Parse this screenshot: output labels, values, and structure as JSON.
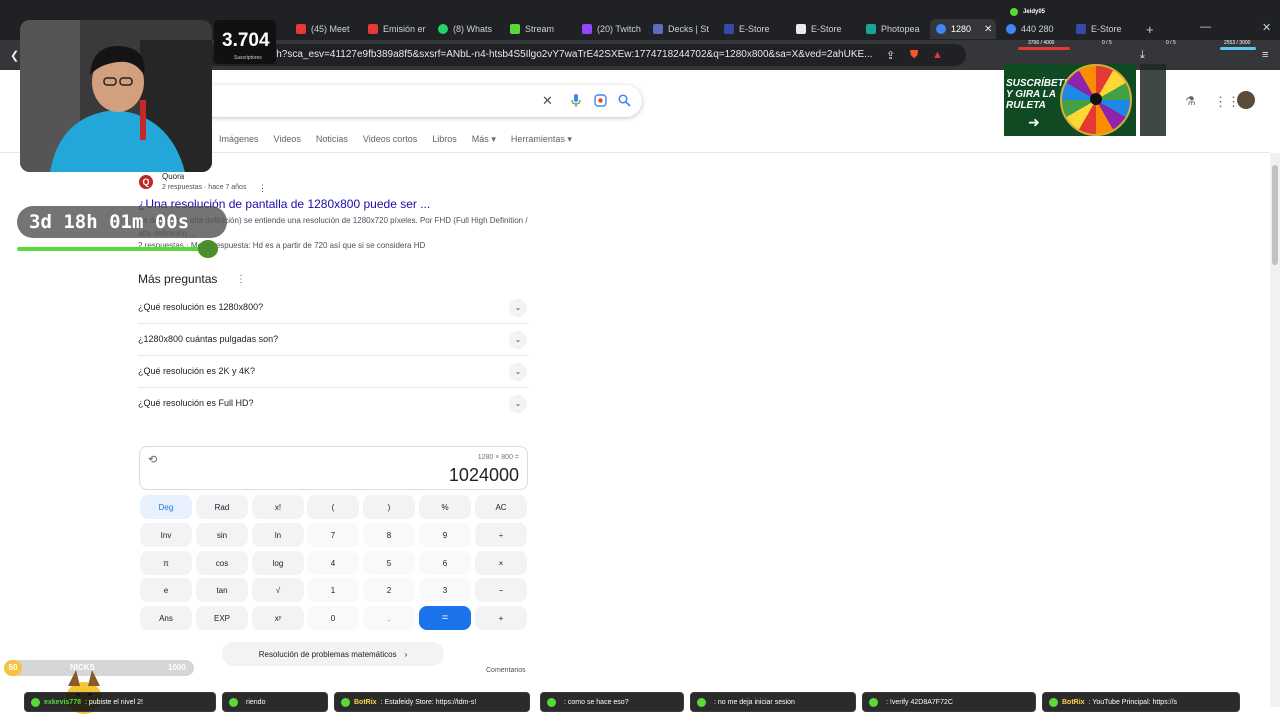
{
  "browser": {
    "tabs": [
      {
        "label": "(45) Meet",
        "color": "#e53935"
      },
      {
        "label": "Emisión en",
        "color": "#e53935"
      },
      {
        "label": "(8) Whats",
        "color": "#25d366"
      },
      {
        "label": "Stream",
        "color": "#57d93a"
      },
      {
        "label": "(20) Twitch",
        "color": "#9146ff"
      },
      {
        "label": "Decks | Str",
        "color": "#5c6bc0"
      },
      {
        "label": "E-Store",
        "color": "#3949ab"
      },
      {
        "label": "E-Store",
        "color": "#e8eaed"
      },
      {
        "label": "Photopea",
        "color": "#18a497"
      },
      {
        "label": "1280",
        "color": "#4285f4"
      },
      {
        "label": "440 280",
        "color": "#4285f4"
      },
      {
        "label": "E-Store",
        "color": "#3949ab"
      }
    ],
    "active_tab_index": 9,
    "url": "gle.com/search?sca_esv=41127e9fb389a8f5&sxsrf=ANbL-n4-htsb4S5Ilgo2vY7waTrE42SXEw:1774718244702&q=1280x800&sa=X&ved=2ahUKE..."
  },
  "google": {
    "filters": [
      "Imágenes",
      "Videos",
      "Noticias",
      "Videos cortos",
      "Libros",
      "Más",
      "Herramientas"
    ],
    "quora": {
      "source": "Quora",
      "meta": "2 respuestas · hace 7 años",
      "title": "¿Una resolución de pantalla de 1280x800 puede ser ...",
      "snippet": "(ta definición / alta definición) se entiende una resolución de 1280x720 píxeles. Por FHD (Full High Definition / alta definición ...",
      "snippet2": "2 respuestas · Mejor respuesta: Hd es a partir de 720 así que si se considera HD"
    },
    "more_questions": {
      "title": "Más preguntas",
      "items": [
        "¿Qué resolución es 1280x800?",
        "¿1280x800 cuántas pulgadas son?",
        "¿Qué resolución es 2K y 4K?",
        "¿Qué resolución es Full HD?"
      ]
    },
    "calculator": {
      "expression": "1280 × 800 =",
      "result": "1024000",
      "keys": [
        [
          "Deg",
          "Rad",
          "x!",
          "(",
          ")",
          "%",
          "AC"
        ],
        [
          "Inv",
          "sin",
          "ln",
          "7",
          "8",
          "9",
          "÷"
        ],
        [
          "π",
          "cos",
          "log",
          "4",
          "5",
          "6",
          "×"
        ],
        [
          "e",
          "tan",
          "√",
          "1",
          "2",
          "3",
          "−"
        ],
        [
          "Ans",
          "EXP",
          "xʸ",
          "0",
          ".",
          "=",
          "+"
        ]
      ]
    },
    "solver_button": "Resolución de problemas matemáticos",
    "feedback": "Comentarios"
  },
  "overlay": {
    "subscribers": "3.704",
    "subscribers_label": "Suscriptores",
    "timer": "3d 18h 01m 00s",
    "roulette_text": "SUSCRÍBETE Y GIRA LA RULETA",
    "top_name": "Jeidy05",
    "meters": [
      {
        "label": "3796 / 4000"
      },
      {
        "label": "0 / 5"
      },
      {
        "label": "0 / 5"
      },
      {
        "label": "2553 / 3000"
      }
    ],
    "level": {
      "left": "50",
      "name": "NICKS",
      "right": "1000"
    },
    "chat": [
      {
        "user": "exkevis778",
        "text": ": pubiste el nivel 2!"
      },
      {
        "user": "",
        "text": "riendo"
      },
      {
        "user": "BotRix",
        "text": ": Estafeidy Store: https://tdm-s!"
      },
      {
        "user": "",
        "text": ": como se hace eso?"
      },
      {
        "user": "",
        "text": ": no me deja iniciar sesion"
      },
      {
        "user": "",
        "text": ": !verify 42D8A7F72C"
      },
      {
        "user": "BotRix",
        "text": ": YouTube Principal: https://s"
      }
    ]
  }
}
